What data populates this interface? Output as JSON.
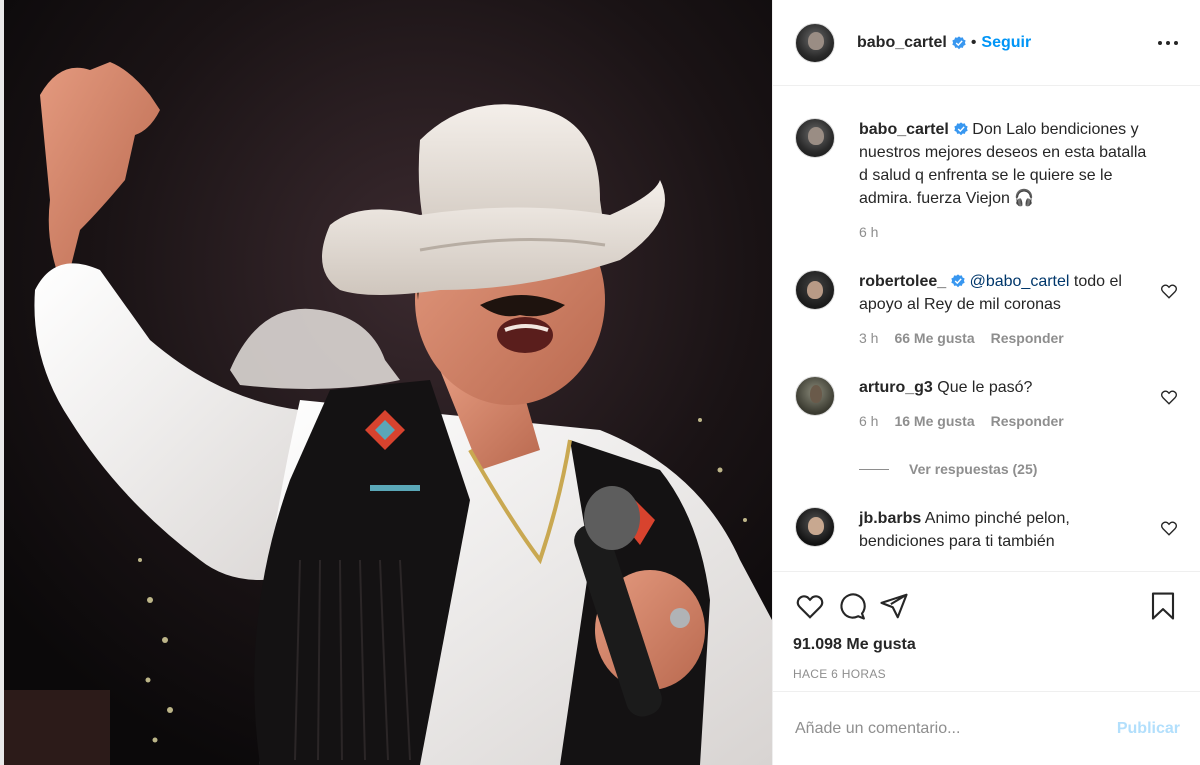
{
  "header": {
    "username": "babo_cartel",
    "separator": "•",
    "follow_label": "Seguir",
    "more_icon": "more-horizontal-icon"
  },
  "caption": {
    "username": "babo_cartel",
    "text": "Don Lalo bendiciones y nuestros mejores deseos en esta batalla d salud q enfrenta se le quiere se le admira. fuerza Viejon 🎧",
    "time": "6 h"
  },
  "comments": [
    {
      "username": "robertolee_",
      "verified": true,
      "mention": "@babo_cartel",
      "text": " todo el apoyo al Rey de mil coronas",
      "time": "3 h",
      "likes": "66 Me gusta",
      "reply": "Responder"
    },
    {
      "username": "arturo_g3",
      "verified": false,
      "text": " Que le pasó?",
      "time": "6 h",
      "likes": "16 Me gusta",
      "reply": "Responder",
      "view_replies": "Ver respuestas (25)"
    },
    {
      "username": "jb.barbs",
      "verified": false,
      "text": " Animo pinché pelon, bendiciones para ti también"
    }
  ],
  "actions": {
    "like_icon": "heart-icon",
    "comment_icon": "comment-icon",
    "share_icon": "share-icon",
    "save_icon": "bookmark-icon"
  },
  "likes_count": "91.098 Me gusta",
  "time_ago": "HACE 6 HORAS",
  "add_comment": {
    "placeholder": "Añade un comentario...",
    "publish_label": "Publicar"
  },
  "colors": {
    "link_blue": "#0095f6",
    "publish_disabled": "#b2dffc",
    "muted": "#8e8e8e",
    "text": "#262626",
    "verified": "#3897f0"
  }
}
